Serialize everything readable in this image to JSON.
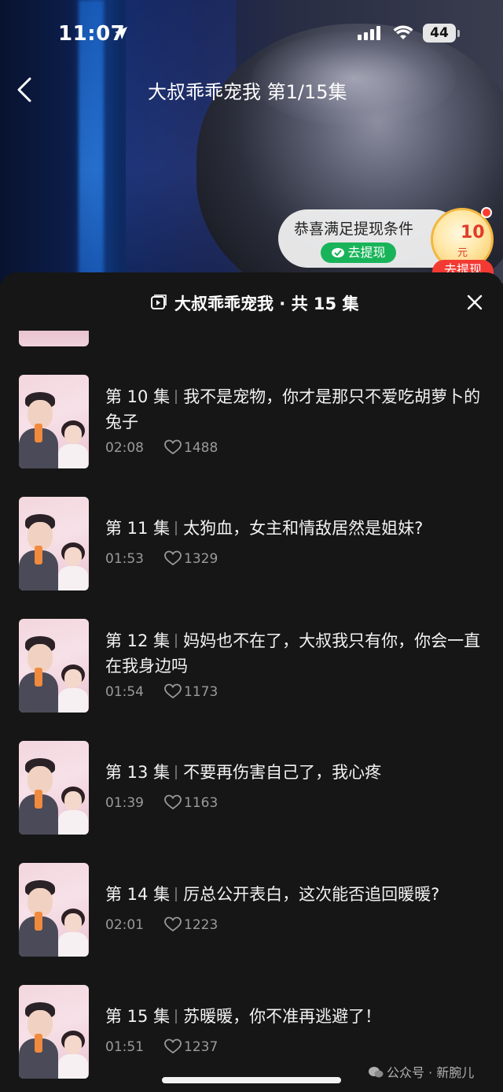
{
  "status_bar": {
    "time": "11:07",
    "battery": "44"
  },
  "header": {
    "title": "大叔乖乖宠我 第1/15集"
  },
  "withdraw": {
    "message": "恭喜满足提现条件",
    "button_label": "去提现",
    "coin_amount": "10",
    "coin_unit": "元",
    "coin_button_label": "去提现"
  },
  "sheet": {
    "title": "大叔乖乖宠我 · 共 15 集"
  },
  "episodes": [
    {
      "number": "第 10 集",
      "title": "我不是宠物，你才是那只不爱吃胡萝卜的兔子",
      "duration": "02:08",
      "likes": "1488"
    },
    {
      "number": "第 11 集",
      "title": "太狗血，女主和情敌居然是姐妹?",
      "duration": "01:53",
      "likes": "1329"
    },
    {
      "number": "第 12 集",
      "title": "妈妈也不在了，大叔我只有你，你会一直在我身边吗",
      "duration": "01:54",
      "likes": "1173"
    },
    {
      "number": "第 13 集",
      "title": "不要再伤害自己了，我心疼",
      "duration": "01:39",
      "likes": "1163"
    },
    {
      "number": "第 14 集",
      "title": "厉总公开表白，这次能否追回暖暖?",
      "duration": "02:01",
      "likes": "1223"
    },
    {
      "number": "第 15 集",
      "title": "苏暖暖，你不准再逃避了！",
      "duration": "01:51",
      "likes": "1237"
    }
  ],
  "watermark": {
    "text": "公众号 · 新腕儿"
  },
  "icons": {
    "back": "chevron-left-icon",
    "close": "close-icon",
    "like": "heart-icon",
    "playlist": "playlist-icon",
    "location": "location-arrow-icon",
    "signal": "signal-icon",
    "wifi": "wifi-icon",
    "wechat_pay": "wechat-pay-icon"
  },
  "colors": {
    "accent_green": "#19b45a",
    "accent_red": "#f23a33",
    "sheet_bg": "#161616"
  }
}
